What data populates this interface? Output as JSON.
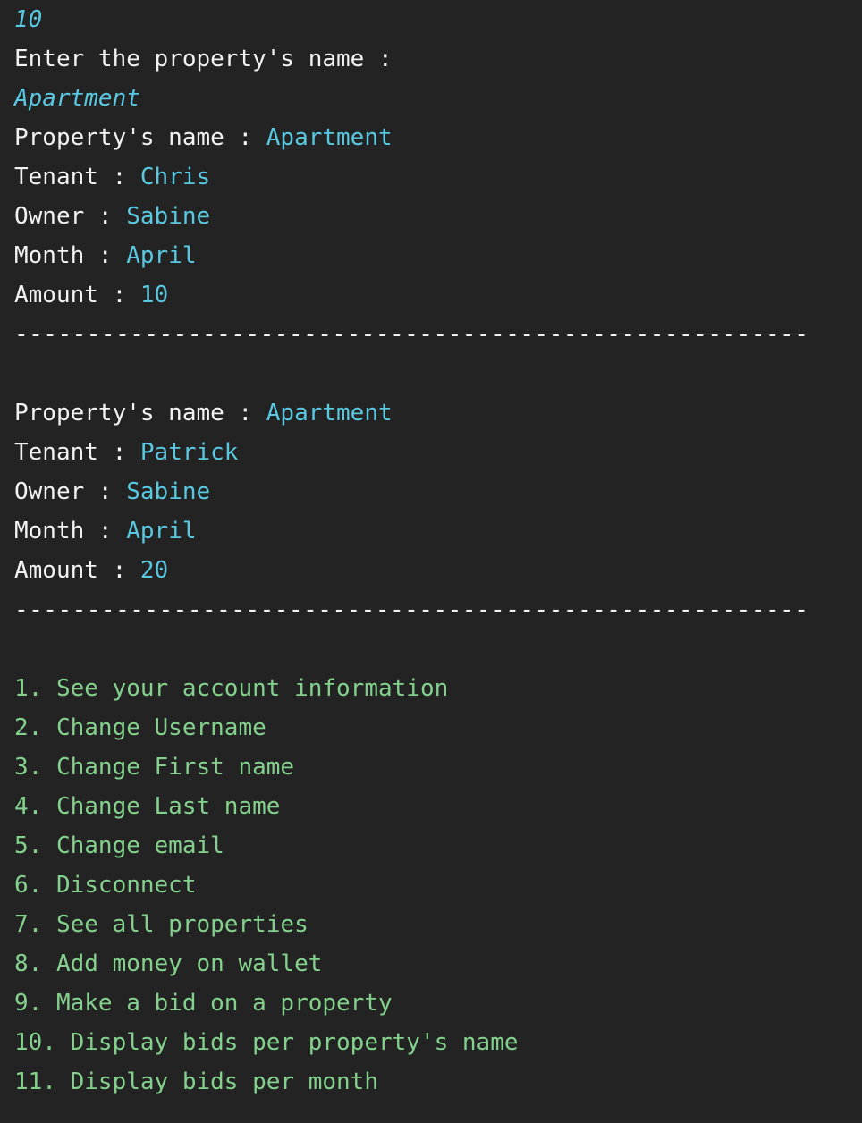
{
  "console": {
    "input_amount": "10",
    "prompt": "Enter the property's name :",
    "input_property": "Apartment",
    "records": [
      {
        "property_label": "Property's name : ",
        "property_value": "Apartment",
        "tenant_label": "Tenant : ",
        "tenant_value": "Chris",
        "owner_label": "Owner : ",
        "owner_value": "Sabine",
        "month_label": "Month : ",
        "month_value": "April",
        "amount_label": "Amount : ",
        "amount_value": "10",
        "separator": "-------------------------------------------------------"
      },
      {
        "property_label": "Property's name : ",
        "property_value": "Apartment",
        "tenant_label": "Tenant : ",
        "tenant_value": "Patrick",
        "owner_label": "Owner : ",
        "owner_value": "Sabine",
        "month_label": "Month : ",
        "month_value": "April",
        "amount_label": "Amount : ",
        "amount_value": "20",
        "separator": "-------------------------------------------------------"
      }
    ],
    "menu": [
      "1. See your account information",
      "2. Change Username",
      "3. Change First name",
      "4. Change Last name",
      "5. Change email",
      "6. Disconnect",
      "7. See all properties",
      "8. Add money on wallet",
      "9. Make a bid on a property",
      "10. Display bids per property's name",
      "11. Display bids per month"
    ]
  },
  "colors": {
    "background": "#232323",
    "text": "#f2f2f2",
    "value": "#59c8e0",
    "menu": "#84d18e"
  }
}
